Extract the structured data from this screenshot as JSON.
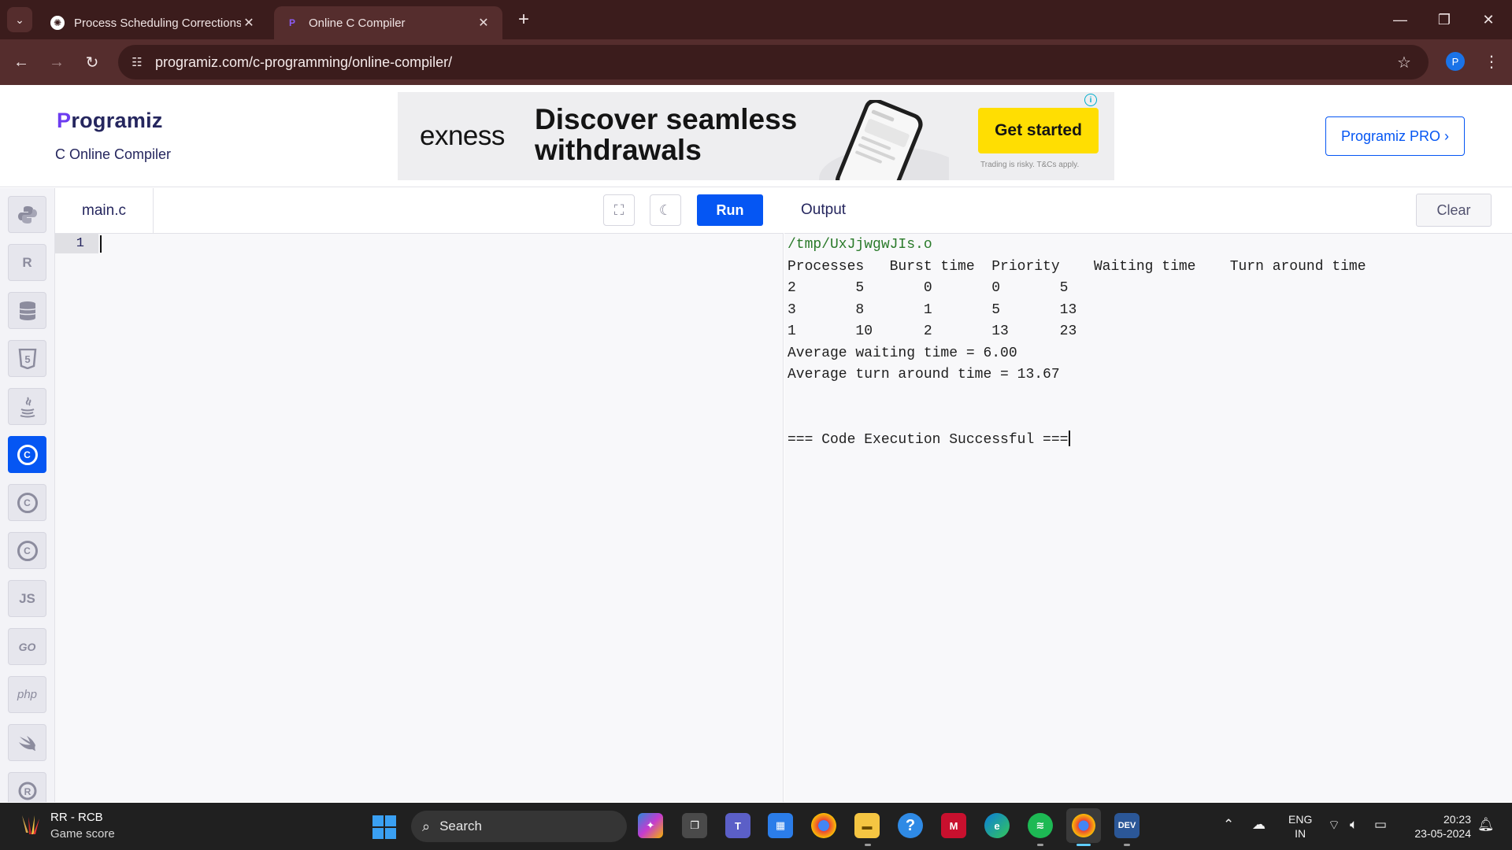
{
  "browser": {
    "tabs": [
      {
        "title": "Process Scheduling Corrections",
        "active": false,
        "icon": "chatgpt-icon"
      },
      {
        "title": "Online C Compiler",
        "active": true,
        "icon": "programiz-icon"
      }
    ],
    "url": "programiz.com/c-programming/online-compiler/",
    "profile_initial": "P"
  },
  "header": {
    "logo_p": "P",
    "logo_rest": "rogramiz",
    "subtitle": "C Online Compiler",
    "pro_button": "Programiz PRO ›"
  },
  "ad": {
    "brand": "exness",
    "headline": "Discover seamless withdrawals",
    "cta": "Get started",
    "disclaimer": "Trading is risky. T&Cs apply.",
    "info": "i"
  },
  "languages": [
    {
      "name": "python-icon",
      "label": ""
    },
    {
      "name": "r-icon",
      "label": "R"
    },
    {
      "name": "sql-icon",
      "label": ""
    },
    {
      "name": "html-icon",
      "label": "5"
    },
    {
      "name": "java-icon",
      "label": ""
    },
    {
      "name": "c-icon",
      "label": "C",
      "active": true
    },
    {
      "name": "cpp-icon",
      "label": "C"
    },
    {
      "name": "csharp-icon",
      "label": "C"
    },
    {
      "name": "js-icon",
      "label": "JS"
    },
    {
      "name": "go-icon",
      "label": "GO"
    },
    {
      "name": "php-icon",
      "label": "php"
    },
    {
      "name": "swift-icon",
      "label": ""
    },
    {
      "name": "rust-icon",
      "label": ""
    }
  ],
  "editor": {
    "file_name": "main.c",
    "run_label": "Run",
    "line_numbers": [
      "1"
    ]
  },
  "output": {
    "title": "Output",
    "clear_label": "Clear",
    "lines": [
      "/tmp/UxJjwgwJIs.o",
      "Processes   Burst time  Priority    Waiting time    Turn around time",
      "2       5       0       0       5",
      "3       8       1       5       13",
      "1       10      2       13      23",
      "Average waiting time = 6.00",
      "Average turn around time = 13.67",
      "",
      "",
      "=== Code Execution Successful ==="
    ]
  },
  "taskbar": {
    "widget_title": "RR - RCB",
    "widget_subtitle": "Game score",
    "search_label": "Search",
    "lang_line1": "ENG",
    "lang_line2": "IN",
    "time": "20:23",
    "date": "23-05-2024"
  },
  "colors": {
    "chrome_dark": "#3b1c1c",
    "chrome_toolbar": "#552d2d",
    "accent": "#0556f3",
    "ad_cta": "#ffde02"
  }
}
